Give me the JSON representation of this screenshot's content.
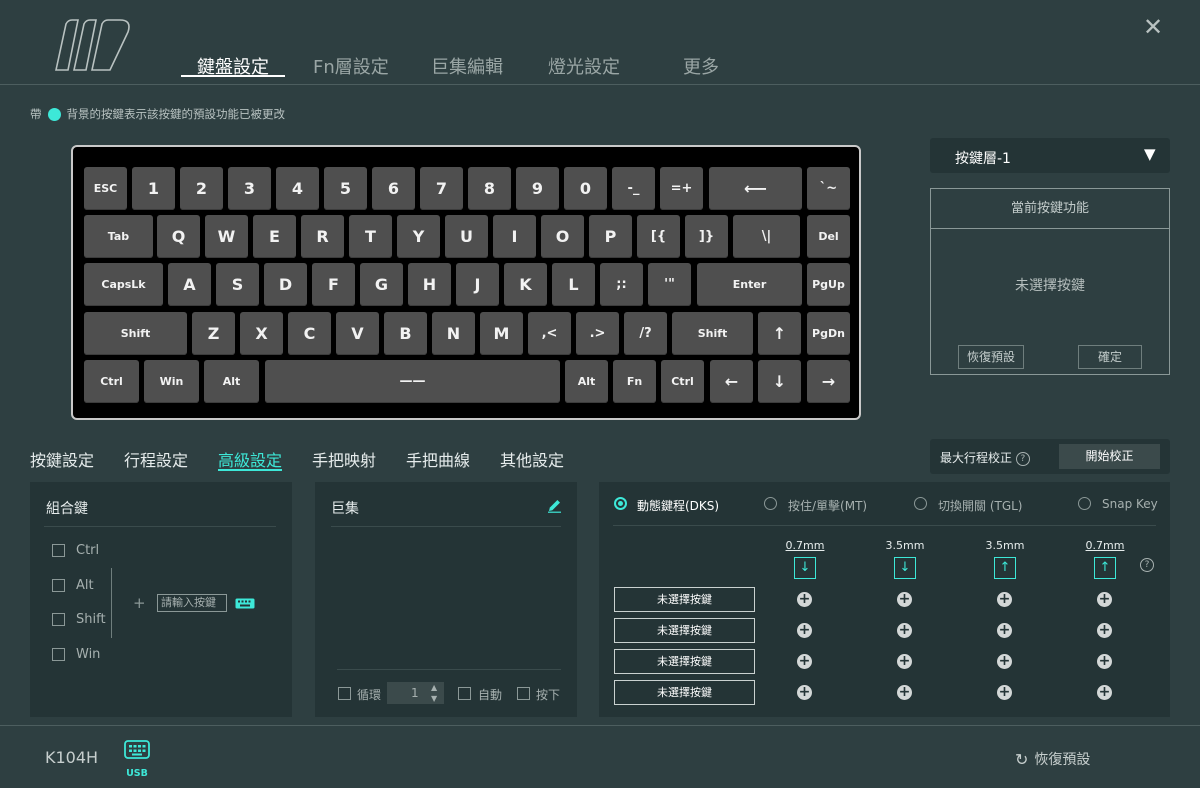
{
  "nav": {
    "tabs": [
      {
        "label": "鍵盤設定",
        "active": true
      },
      {
        "label": "Fn層設定",
        "active": false
      },
      {
        "label": "巨集編輯",
        "active": false
      },
      {
        "label": "燈光設定",
        "active": false
      },
      {
        "label": "更多",
        "active": false
      }
    ]
  },
  "hint": {
    "prefix": "帶",
    "text": "背景的按鍵表示該按鍵的預設功能已被更改"
  },
  "keyboard": {
    "rows": [
      [
        "ESC",
        "1",
        "2",
        "3",
        "4",
        "5",
        "6",
        "7",
        "8",
        "9",
        "0",
        "-_",
        "=+",
        "⟵",
        "`~"
      ],
      [
        "Tab",
        "Q",
        "W",
        "E",
        "R",
        "T",
        "Y",
        "U",
        "I",
        "O",
        "P",
        "[{",
        "]}",
        "\\|",
        "Del"
      ],
      [
        "CapsLk",
        "A",
        "S",
        "D",
        "F",
        "G",
        "H",
        "J",
        "K",
        "L",
        ";:",
        "'\"",
        "Enter",
        "PgUp"
      ],
      [
        "Shift",
        "Z",
        "X",
        "C",
        "V",
        "B",
        "N",
        "M",
        ",<",
        ".>",
        "/?",
        "Shift",
        "↑",
        "PgDn"
      ],
      [
        "Ctrl",
        "Win",
        "Alt",
        "——",
        "Alt",
        "Fn",
        "Ctrl",
        "←",
        "↓",
        "→"
      ]
    ]
  },
  "layer": {
    "selected": "按鍵層-1",
    "arrow": "▼"
  },
  "current_fn": {
    "title": "當前按鍵功能",
    "empty": "未選擇按鍵",
    "reset": "恢復預設",
    "confirm": "確定"
  },
  "subtabs": [
    {
      "label": "按鍵設定",
      "active": false
    },
    {
      "label": "行程設定",
      "active": false
    },
    {
      "label": "高級設定",
      "active": true
    },
    {
      "label": "手把映射",
      "active": false
    },
    {
      "label": "手把曲線",
      "active": false
    },
    {
      "label": "其他設定",
      "active": false
    }
  ],
  "calibration": {
    "label": "最大行程校正",
    "help": "?",
    "button": "開始校正"
  },
  "combo": {
    "title": "組合鍵",
    "modifiers": [
      "Ctrl",
      "Alt",
      "Shift",
      "Win"
    ],
    "plus": "+",
    "placeholder": "請輸入按鍵"
  },
  "macro": {
    "title": "巨集",
    "loop_label": "循環",
    "loop_value": "1",
    "auto_label": "自動",
    "press_label": "按下"
  },
  "dks": {
    "modes": [
      {
        "label": "動態鍵程(DKS)",
        "selected": true
      },
      {
        "label": "按住/單擊(MT)",
        "selected": false
      },
      {
        "label": "切換開關 (TGL)",
        "selected": false
      },
      {
        "label": "Snap Key",
        "selected": false
      }
    ],
    "points": [
      {
        "value": "0.7mm",
        "underlined": true,
        "icon": "↓"
      },
      {
        "value": "3.5mm",
        "underlined": false,
        "icon": "↓"
      },
      {
        "value": "3.5mm",
        "underlined": false,
        "icon": "↑"
      },
      {
        "value": "0.7mm",
        "underlined": true,
        "icon": "↑"
      }
    ],
    "help": "?",
    "key_slots": [
      "未選擇按鍵",
      "未選擇按鍵",
      "未選擇按鍵",
      "未選擇按鍵"
    ],
    "plus": "+"
  },
  "footer": {
    "model": "K104H",
    "connection": "USB",
    "restore": "恢復預設"
  },
  "colors": {
    "accent": "#3de8d8",
    "background": "#2e3f41",
    "panel": "#243436"
  }
}
